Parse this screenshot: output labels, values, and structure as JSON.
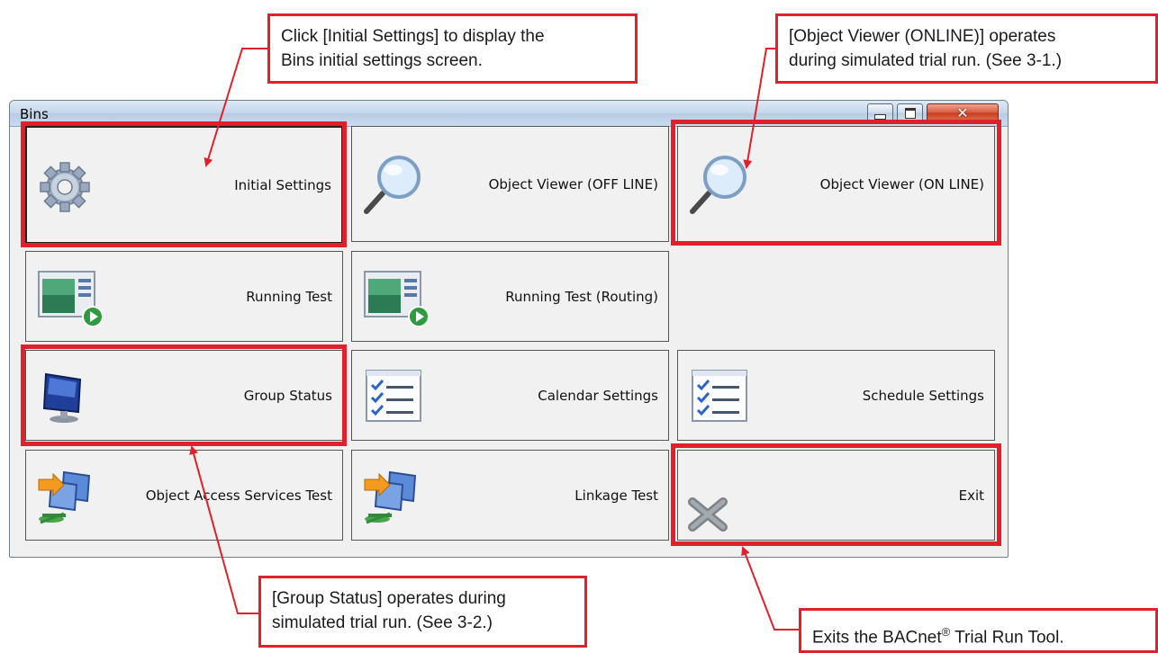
{
  "window": {
    "title": "Bins"
  },
  "tiles": [
    {
      "label": "Initial Settings",
      "icon": "gear-icon"
    },
    {
      "label": "Object Viewer (OFF LINE)",
      "icon": "magnifier-icon"
    },
    {
      "label": "Object Viewer (ON LINE)",
      "icon": "magnifier-icon"
    },
    {
      "label": "Running Test",
      "icon": "running-test-icon"
    },
    {
      "label": "Running Test (Routing)",
      "icon": "running-test-icon"
    },
    {
      "label": "Group Status",
      "icon": "monitor-icon"
    },
    {
      "label": "Calendar Settings",
      "icon": "checklist-icon"
    },
    {
      "label": "Schedule Settings",
      "icon": "checklist-icon"
    },
    {
      "label": "Object Access Services Test",
      "icon": "network-icon"
    },
    {
      "label": "Linkage Test",
      "icon": "network-icon"
    },
    {
      "label": "Exit",
      "icon": "close-x-icon"
    }
  ],
  "callouts": {
    "initial_settings_1": "Click [Initial Settings] to display the",
    "initial_settings_2": "Bins initial settings screen.",
    "object_viewer_1": "[Object Viewer (ONLINE)] operates",
    "object_viewer_2": "during simulated trial run. (See 3-1.)",
    "group_status_1": "[Group Status] operates during",
    "group_status_2": "simulated trial run. (See 3-2.)",
    "exit_before": "Exits the BACnet",
    "exit_reg": "®",
    "exit_after": " Trial Run Tool."
  },
  "colors": {
    "highlight": "#e0202a",
    "titlebar": "#c3d6ea",
    "close_button": "#d9583b"
  }
}
